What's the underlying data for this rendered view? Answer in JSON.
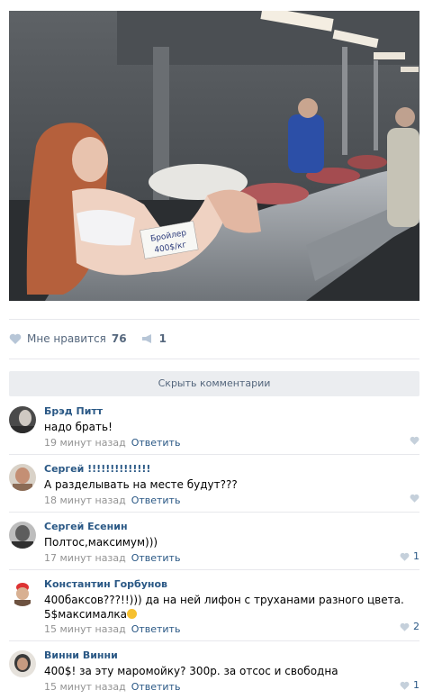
{
  "post": {
    "likes_label": "Мне нравится",
    "likes_count": "76",
    "shares_count": "1",
    "sign_line1": "Бройлер",
    "sign_line2": "400$/кг"
  },
  "hide_comments_label": "Скрыть комментарии",
  "comments": [
    {
      "author": "Брэд Питт",
      "text": "надо брать!",
      "time": "19 минут назад",
      "reply": "Ответить",
      "likes": ""
    },
    {
      "author": "Сергей !!!!!!!!!!!!!!",
      "text": "А разделывать на месте будут???",
      "time": "18 минут назад",
      "reply": "Ответить",
      "likes": ""
    },
    {
      "author": "Сергей Есенин",
      "text": "Полтос,максимум)))",
      "time": "17 минут назад",
      "reply": "Ответить",
      "likes": "1"
    },
    {
      "author": "Константин Горбунов",
      "text": "400баксов???!!))) да на ней лифон с труханами разного цвета.",
      "text2": "5$максималка",
      "time": "15 минут назад",
      "reply": "Ответить",
      "likes": "2"
    },
    {
      "author": "Винни Винни",
      "text": "400$! за эту маромойку? 300р. за отсос и свободна",
      "time": "15 минут назад",
      "reply": "Ответить",
      "likes": "1"
    }
  ],
  "colors": {
    "link": "#2a5885",
    "muted": "#939393",
    "separator": "#e7e8ec",
    "button_bg": "#ebedf0"
  },
  "icons": {
    "like": "heart-icon",
    "share": "megaphone-icon"
  }
}
